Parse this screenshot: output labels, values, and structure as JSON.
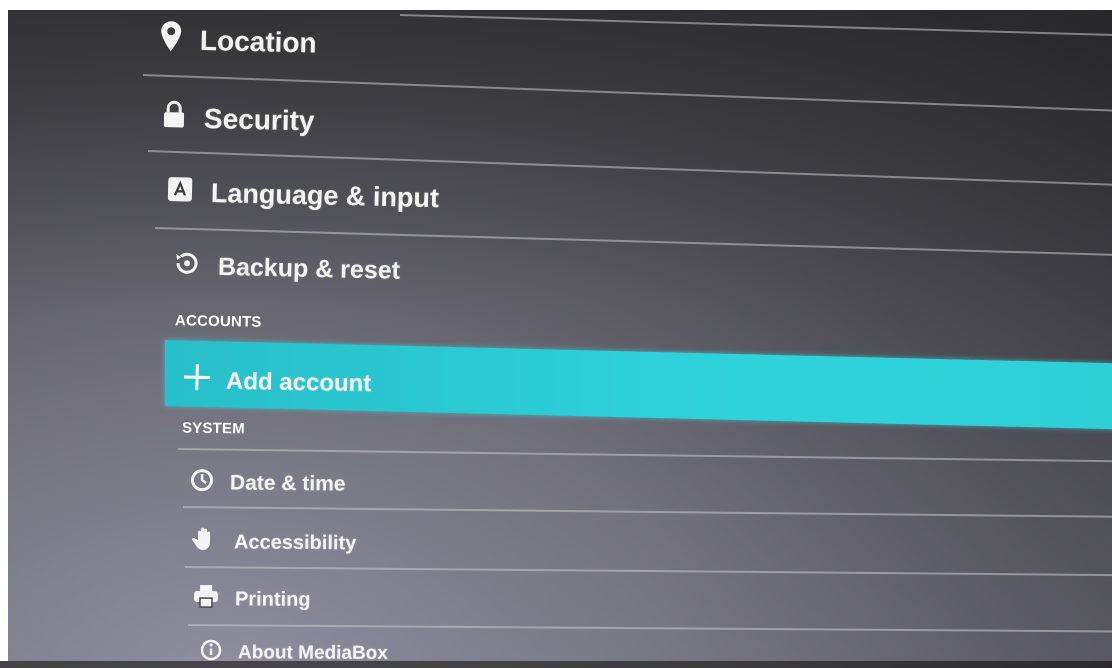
{
  "menu": {
    "location_label": "Location",
    "security_label": "Security",
    "language_label": "Language & input",
    "backup_label": "Backup & reset"
  },
  "accounts": {
    "header": "ACCOUNTS",
    "add_account_label": "Add account"
  },
  "system": {
    "header": "SYSTEM",
    "date_time_label": "Date & time",
    "accessibility_label": "Accessibility",
    "printing_label": "Printing",
    "about_label": "About MediaBox"
  },
  "colors": {
    "highlight": "#2fd3dc",
    "text": "#f4f4f4"
  },
  "icons": {
    "location": "location-pin-icon",
    "security": "lock-icon",
    "language": "keyboard-a-icon",
    "backup": "backup-restore-icon",
    "add": "plus-icon",
    "date_time": "clock-icon",
    "accessibility": "hand-icon",
    "printing": "printer-icon",
    "about": "info-icon"
  }
}
